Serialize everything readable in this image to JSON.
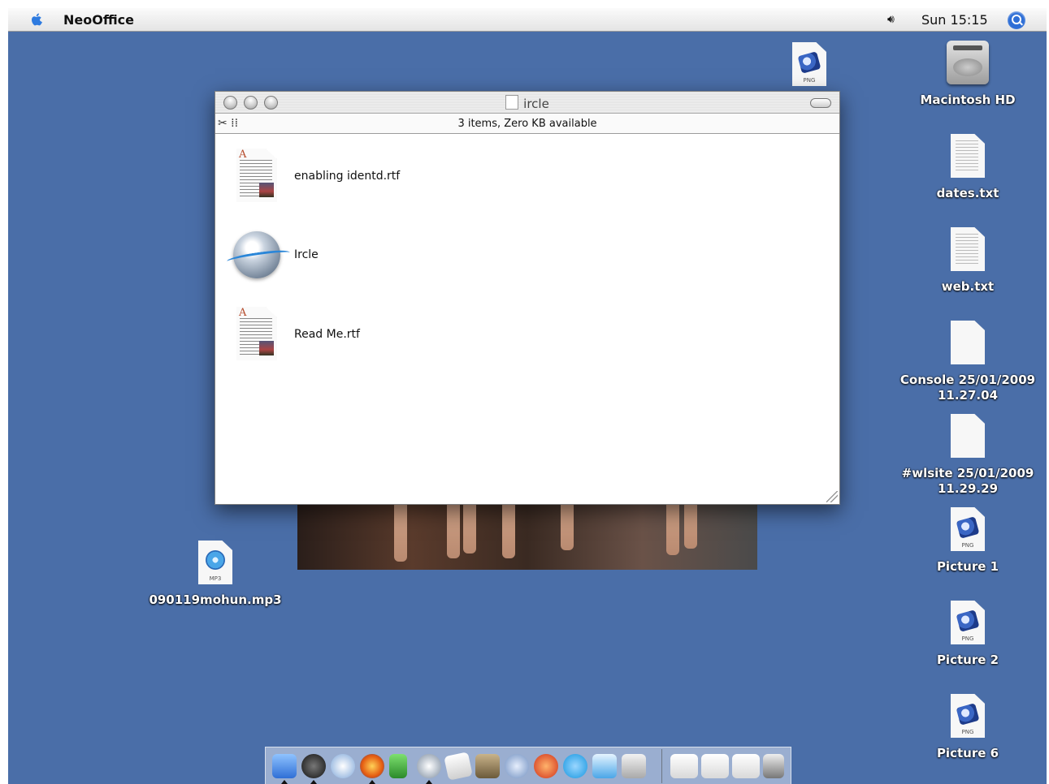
{
  "menubar": {
    "app_name": "NeoOffice",
    "clock": "Sun 15:15",
    "volume_glyph": "🔊︎"
  },
  "desktop_icons": [
    {
      "label": "Macintosh HD",
      "type": "hard-drive"
    },
    {
      "label": "dates.txt",
      "type": "text-doc"
    },
    {
      "label": "web.txt",
      "type": "text-doc"
    },
    {
      "label": "Console 25/01/2009\n11.27.04",
      "type": "blank-doc"
    },
    {
      "label": "#wlsite 25/01/2009\n11.29.29",
      "type": "blank-doc"
    },
    {
      "label": "Picture 1",
      "type": "png",
      "tag": "PNG"
    },
    {
      "label": "Picture 2",
      "type": "png",
      "tag": "PNG"
    },
    {
      "label": "Picture 6",
      "type": "png",
      "tag": "PNG"
    },
    {
      "label": "090119mohun.mp3",
      "type": "mp3",
      "tag": "MP3"
    },
    {
      "label": "",
      "type": "png",
      "tag": "PNG"
    }
  ],
  "window": {
    "title": "ircle",
    "info": "3 items, Zero KB available",
    "tools_glyph": "✂ ⁞⁞",
    "files": [
      {
        "name": "enabling identd.rtf",
        "icon": "rtf-document-icon",
        "glyph": "A"
      },
      {
        "name": "Ircle",
        "icon": "ircle-app-icon"
      },
      {
        "name": "Read Me.rtf",
        "icon": "rtf-document-icon",
        "glyph": "A"
      }
    ]
  },
  "dock": {
    "items": [
      "finder",
      "dashboard",
      "mail",
      "firefox",
      "adium",
      "ircle",
      "textedit",
      "gimp",
      "network",
      "itunes-radio",
      "skype",
      "itunes",
      "preferences"
    ],
    "minimized": [
      "firefox-window-1",
      "firefox-window-2",
      "window-3"
    ],
    "trash": "trash"
  }
}
